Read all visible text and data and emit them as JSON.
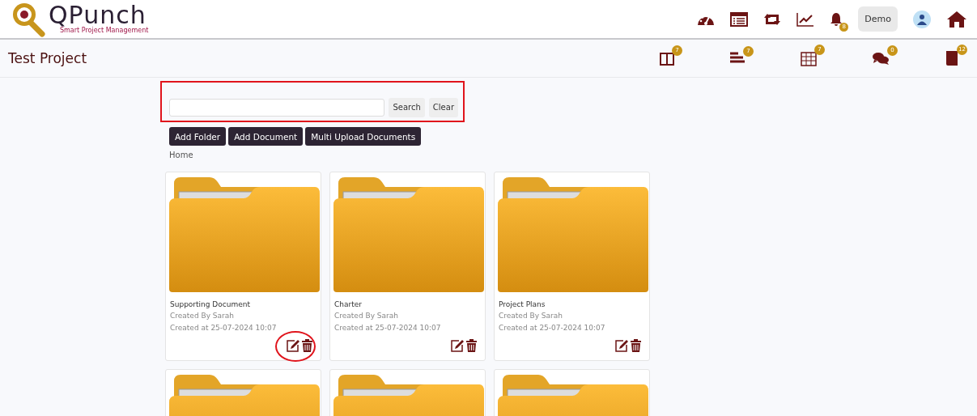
{
  "brand": {
    "name": "QPunch",
    "tagline": "Smart Project Management"
  },
  "top_nav": [
    {
      "kind": "dashboard"
    },
    {
      "kind": "list"
    },
    {
      "kind": "swap"
    },
    {
      "kind": "chart"
    },
    {
      "kind": "bell",
      "badge": "8"
    },
    {
      "kind": "user",
      "label": "Demo"
    },
    {
      "kind": "avatar"
    },
    {
      "kind": "home"
    }
  ],
  "project": {
    "title": "Test Project"
  },
  "project_nav": [
    {
      "kind": "board",
      "badge": "7"
    },
    {
      "kind": "tasks",
      "badge": "7"
    },
    {
      "kind": "calendar",
      "badge": "7"
    },
    {
      "kind": "chat",
      "badge": "0"
    },
    {
      "kind": "book",
      "badge": "12"
    }
  ],
  "search": {
    "buttons": [
      "Search",
      "Clear"
    ],
    "highlighted": true
  },
  "actions": [
    "Add Folder",
    "Add Document",
    "Multi Upload Documents"
  ],
  "breadcrumb": "Home",
  "folders": [
    {
      "kind": "folder",
      "name": "Supporting Document",
      "created_by": "Created By Sarah",
      "created_at": "Created at 25-07-2024 10:07",
      "highlighted": true
    },
    {
      "kind": "folder",
      "name": "Charter",
      "created_by": "Created By Sarah",
      "created_at": "Created at 25-07-2024 10:07",
      "highlighted": false
    },
    {
      "kind": "folder",
      "name": "Project Plans",
      "created_by": "Created By Sarah",
      "created_at": "Created at 25-07-2024 10:07",
      "highlighted": false
    },
    {
      "kind": "folder-partial"
    },
    {
      "kind": "folder-partial"
    },
    {
      "kind": "folder-partial"
    }
  ]
}
